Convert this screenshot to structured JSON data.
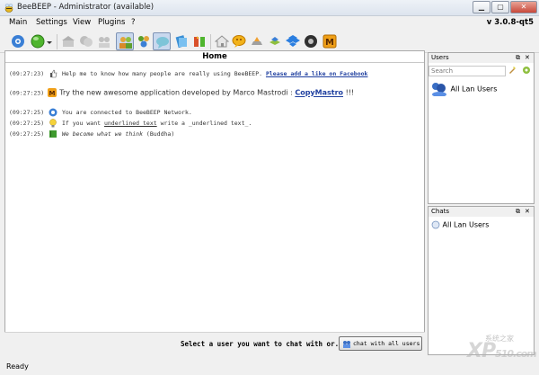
{
  "window": {
    "title": "BeeBEEP - Administrator (available)"
  },
  "menubar": {
    "items": [
      "Main",
      "Settings",
      "View",
      "Plugins",
      "?"
    ],
    "version": "v 3.0.8-qt5"
  },
  "home": {
    "title": "Home",
    "messages": [
      {
        "time": "(09:27:23)",
        "text": "Help me to know how many people are really using BeeBEEP.",
        "link": "Please add a like on Facebook"
      },
      {
        "time": "(09:27:23)",
        "text": "Try the new awesome application developed by Marco Mastrodi :",
        "link": "CopyMastro",
        "suffix": "!!!"
      },
      {
        "time": "(09:27:25)",
        "text": "You are connected to BeeBEEP Network."
      },
      {
        "time": "(09:27:25)",
        "text_before": "If you want",
        "underlined": "underlined text",
        "text_after": "write a _underlined text_."
      },
      {
        "time": "(09:27:25)",
        "quote": "We become what we think",
        "author": "(Buddha)"
      }
    ]
  },
  "bottom": {
    "prompt": "Select a user you want to chat with or...",
    "chat_all_button": "chat with all users"
  },
  "status": {
    "text": "Ready"
  },
  "users_dock": {
    "title": "Users",
    "search_placeholder": "Search",
    "items": [
      "All Lan Users"
    ]
  },
  "chats_dock": {
    "title": "Chats",
    "items": [
      "All Lan Users"
    ]
  },
  "watermark": {
    "text": "XP",
    "subtext": "510.com",
    "cn_text": "系统之家"
  }
}
